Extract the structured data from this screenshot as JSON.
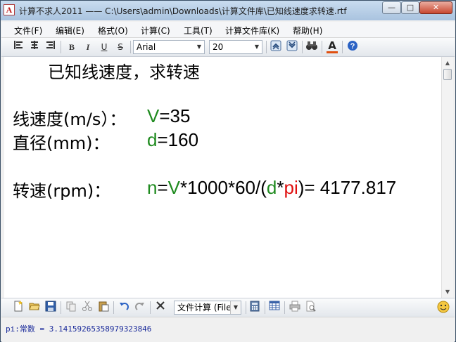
{
  "window": {
    "title": "计算不求人2011 —— C:\\Users\\admin\\Downloads\\计算文件库\\已知线速度求转速.rtf",
    "app_icon_letter": "A",
    "minimize_glyph": "—",
    "maximize_glyph": "□",
    "close_glyph": "✕"
  },
  "menu": [
    {
      "label": "文件(F)"
    },
    {
      "label": "编辑(E)"
    },
    {
      "label": "格式(O)"
    },
    {
      "label": "计算(C)"
    },
    {
      "label": "工具(T)"
    },
    {
      "label": "计算文件库(K)"
    },
    {
      "label": "帮助(H)"
    }
  ],
  "toolbar": {
    "bold_glyph": "B",
    "italic_glyph": "I",
    "underline_glyph": "U",
    "strike_glyph": "S",
    "font_name": "Arial",
    "font_size": "20",
    "color_glyph": "A",
    "help_glyph": "?"
  },
  "document": {
    "heading": "已知线速度，求转速",
    "row1": {
      "label": "线速度(m/s）：",
      "var": "V",
      "rest": "=35"
    },
    "row2": {
      "label": "直径(mm)：",
      "var": "d",
      "rest": "=160"
    },
    "row3": {
      "label": "转速(rpm)：",
      "n": "n",
      "eq": "=",
      "V": "V",
      "mid": "*1000*60/(",
      "d": "d",
      "star": "*",
      "pi": "pi",
      "result": ")= 4177.817"
    }
  },
  "bottom_toolbar": {
    "mode_select": "文件计算 (File)"
  },
  "status": {
    "text": "pi:常数 = 3.14159265358979323846"
  },
  "colors": {
    "variable": "#1e8a1e",
    "constant": "#e01010"
  },
  "icons": {
    "align-left": "align-left-icon",
    "align-center": "align-center-icon",
    "align-right": "align-right-icon",
    "find": "binoculars-icon",
    "help": "help-icon"
  }
}
